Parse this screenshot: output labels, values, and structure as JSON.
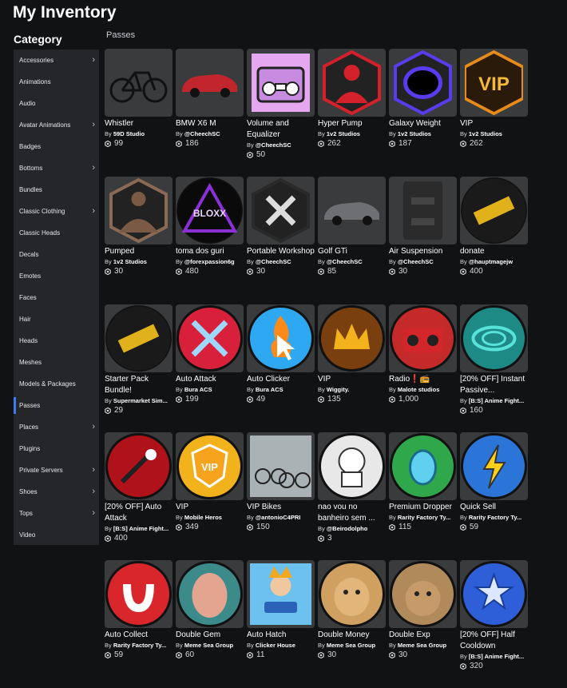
{
  "header": {
    "title": "My Inventory"
  },
  "sidebar": {
    "heading": "Category",
    "items": [
      {
        "label": "Accessories",
        "chevron": true
      },
      {
        "label": "Animations",
        "chevron": false
      },
      {
        "label": "Audio",
        "chevron": false
      },
      {
        "label": "Avatar Animations",
        "chevron": true
      },
      {
        "label": "Badges",
        "chevron": false
      },
      {
        "label": "Bottoms",
        "chevron": true
      },
      {
        "label": "Bundles",
        "chevron": false
      },
      {
        "label": "Classic Clothing",
        "chevron": true
      },
      {
        "label": "Classic Heads",
        "chevron": false
      },
      {
        "label": "Decals",
        "chevron": false
      },
      {
        "label": "Emotes",
        "chevron": false
      },
      {
        "label": "Faces",
        "chevron": false
      },
      {
        "label": "Hair",
        "chevron": false
      },
      {
        "label": "Heads",
        "chevron": false
      },
      {
        "label": "Meshes",
        "chevron": false
      },
      {
        "label": "Models & Packages",
        "chevron": false
      },
      {
        "label": "Passes",
        "chevron": false,
        "active": true
      },
      {
        "label": "Places",
        "chevron": true
      },
      {
        "label": "Plugins",
        "chevron": false
      },
      {
        "label": "Private Servers",
        "chevron": true
      },
      {
        "label": "Shoes",
        "chevron": true
      },
      {
        "label": "Tops",
        "chevron": true
      },
      {
        "label": "Video",
        "chevron": false
      }
    ]
  },
  "main": {
    "section_label": "Passes",
    "items": [
      {
        "name": "Whistler",
        "by": "By",
        "creator": "59D Studio",
        "price": "99",
        "icon": "bicycle-icon",
        "bg": "#3a3b3e",
        "shape": "square",
        "accent": "#1b1b1b"
      },
      {
        "name": "BMW X6 M",
        "by": "By",
        "creator": "@CheechSC",
        "price": "186",
        "icon": "car-icon",
        "bg": "#3a3b3e",
        "shape": "square",
        "accent": "#c0262b"
      },
      {
        "name": "Volume and Equalizer",
        "by": "By",
        "creator": "@CheechSC",
        "price": "50",
        "icon": "boombox-icon",
        "bg": "#3a3b3e",
        "shape": "square",
        "accent": "#c78be0"
      },
      {
        "name": "Hyper Pump",
        "by": "By",
        "creator": "1v2 Studios",
        "price": "262",
        "icon": "muscle-icon",
        "bg": "#3a3b3e",
        "shape": "hex",
        "accent": "#d4202a"
      },
      {
        "name": "Galaxy Weight",
        "by": "By",
        "creator": "1v2 Studios",
        "price": "187",
        "icon": "portal-icon",
        "bg": "#3a3b3e",
        "shape": "hex",
        "accent": "#5a3cf0"
      },
      {
        "name": "VIP",
        "by": "By",
        "creator": "1v2 Studios",
        "price": "262",
        "icon": "vip-badge-icon",
        "bg": "#3a3b3e",
        "shape": "hex",
        "accent": "#e88b1a"
      },
      {
        "name": "Pumped",
        "by": "By",
        "creator": "1v2 Studios",
        "price": "30",
        "icon": "bodybuilder-icon",
        "bg": "#3a3b3e",
        "shape": "hex",
        "accent": "#8a6a55"
      },
      {
        "name": "toma dos guri",
        "by": "By",
        "creator": "@forexpassion6g",
        "price": "480",
        "icon": "bloxx-store-icon",
        "bg": "#3a3b3e",
        "shape": "circle",
        "accent": "#8b2fd6"
      },
      {
        "name": "Portable Workshop",
        "by": "By",
        "creator": "@CheechSC",
        "price": "30",
        "icon": "tools-icon",
        "bg": "#3a3b3e",
        "shape": "hex",
        "accent": "#2a2a2a"
      },
      {
        "name": "Golf GTi",
        "by": "By",
        "creator": "@CheechSC",
        "price": "85",
        "icon": "hatchback-icon",
        "bg": "#3a3b3e",
        "shape": "square",
        "accent": "#6e6f73"
      },
      {
        "name": "Air Suspension",
        "by": "By",
        "creator": "@CheechSC",
        "price": "30",
        "icon": "suspension-panel-icon",
        "bg": "#3a3b3e",
        "shape": "square",
        "accent": "#222"
      },
      {
        "name": "donate",
        "by": "By",
        "creator": "@hauptmagejw",
        "price": "400",
        "icon": "ticket-icon",
        "bg": "#3a3b3e",
        "shape": "circle",
        "accent": "#e0b11b"
      },
      {
        "name": "Starter Pack Bundle!",
        "by": "By",
        "creator": "Supermarket Sim...",
        "price": "29",
        "icon": "ticket-icon",
        "bg": "#3a3b3e",
        "shape": "circle",
        "accent": "#e0b11b"
      },
      {
        "name": "Auto Attack",
        "by": "By",
        "creator": "Bura ACS",
        "price": "199",
        "icon": "swords-icon",
        "bg": "#3a3b3e",
        "shape": "circle",
        "accent": "#d8203a"
      },
      {
        "name": "Auto Clicker",
        "by": "By",
        "creator": "Bura ACS",
        "price": "49",
        "icon": "cursor-fire-icon",
        "bg": "#3a3b3e",
        "shape": "circle",
        "accent": "#2ea8f0"
      },
      {
        "name": "VIP",
        "by": "By",
        "creator": "Wiggity.",
        "price": "135",
        "icon": "crown-icon",
        "bg": "#3a3b3e",
        "shape": "circle",
        "accent": "#7a3f0f"
      },
      {
        "name": "Radio❗📻",
        "by": "By",
        "creator": "Malote studios",
        "price": "1,000",
        "icon": "radio-icon",
        "bg": "#3a3b3e",
        "shape": "circle",
        "accent": "#c42a2a"
      },
      {
        "name": "[20% OFF] Instant Passive...",
        "by": "By",
        "creator": "[B:S] Anime Fight...",
        "price": "160",
        "icon": "swirl-icon",
        "bg": "#3a3b3e",
        "shape": "circle",
        "accent": "#1d8a85"
      },
      {
        "name": "[20% OFF] Auto Attack",
        "by": "By",
        "creator": "[B:S] Anime Fight...",
        "price": "400",
        "icon": "target-sword-icon",
        "bg": "#3a3b3e",
        "shape": "circle",
        "accent": "#b0121a"
      },
      {
        "name": "VIP",
        "by": "By",
        "creator": "Mobile Heros",
        "price": "349",
        "icon": "vip-shield-icon",
        "bg": "#3a3b3e",
        "shape": "circle",
        "accent": "#f2b21c"
      },
      {
        "name": "VIP Bikes",
        "by": "By",
        "creator": "@antonioC4PRI",
        "price": "150",
        "icon": "bikes-icon",
        "bg": "#3a3b3e",
        "shape": "square",
        "accent": "#7f8c8d"
      },
      {
        "name": "nao vou no banheiro sem ...",
        "by": "By",
        "creator": "@Beirodolpho",
        "price": "3",
        "icon": "toilet-icon",
        "bg": "#3a3b3e",
        "shape": "circle",
        "accent": "#e8e8e8"
      },
      {
        "name": "Premium Dropper",
        "by": "By",
        "creator": "Rarity Factory Ty...",
        "price": "115",
        "icon": "egg-icon",
        "bg": "#3a3b3e",
        "shape": "circle",
        "accent": "#2ea84a"
      },
      {
        "name": "Quick Sell",
        "by": "By",
        "creator": "Rarity Factory Ty...",
        "price": "59",
        "icon": "lightning-icon",
        "bg": "#3a3b3e",
        "shape": "circle",
        "accent": "#2b74d8"
      },
      {
        "name": "Auto Collect",
        "by": "By",
        "creator": "Rarity Factory Ty...",
        "price": "59",
        "icon": "magnet-icon",
        "bg": "#3a3b3e",
        "shape": "circle",
        "accent": "#d8262b"
      },
      {
        "name": "Double Gem",
        "by": "By",
        "creator": "Meme Sea Group",
        "price": "60",
        "icon": "fish-icon",
        "bg": "#3a3b3e",
        "shape": "circle",
        "accent": "#3c8a8a"
      },
      {
        "name": "Auto Hatch",
        "by": "By",
        "creator": "Clicker House",
        "price": "11",
        "icon": "character-icon",
        "bg": "#3a3b3e",
        "shape": "square",
        "accent": "#3aa3e0"
      },
      {
        "name": "Double Money",
        "by": "By",
        "creator": "Meme Sea Group",
        "price": "30",
        "icon": "doge-icon",
        "bg": "#3a3b3e",
        "shape": "circle",
        "accent": "#d0a060"
      },
      {
        "name": "Double Exp",
        "by": "By",
        "creator": "Meme Sea Group",
        "price": "30",
        "icon": "cat-icon",
        "bg": "#3a3b3e",
        "shape": "circle",
        "accent": "#b08a5a"
      },
      {
        "name": "[20% OFF] Half Cooldown",
        "by": "By",
        "creator": "[B:S] Anime Fight...",
        "price": "320",
        "icon": "stars-icon",
        "bg": "#3a3b3e",
        "shape": "circle",
        "accent": "#2e5fd8"
      }
    ]
  }
}
